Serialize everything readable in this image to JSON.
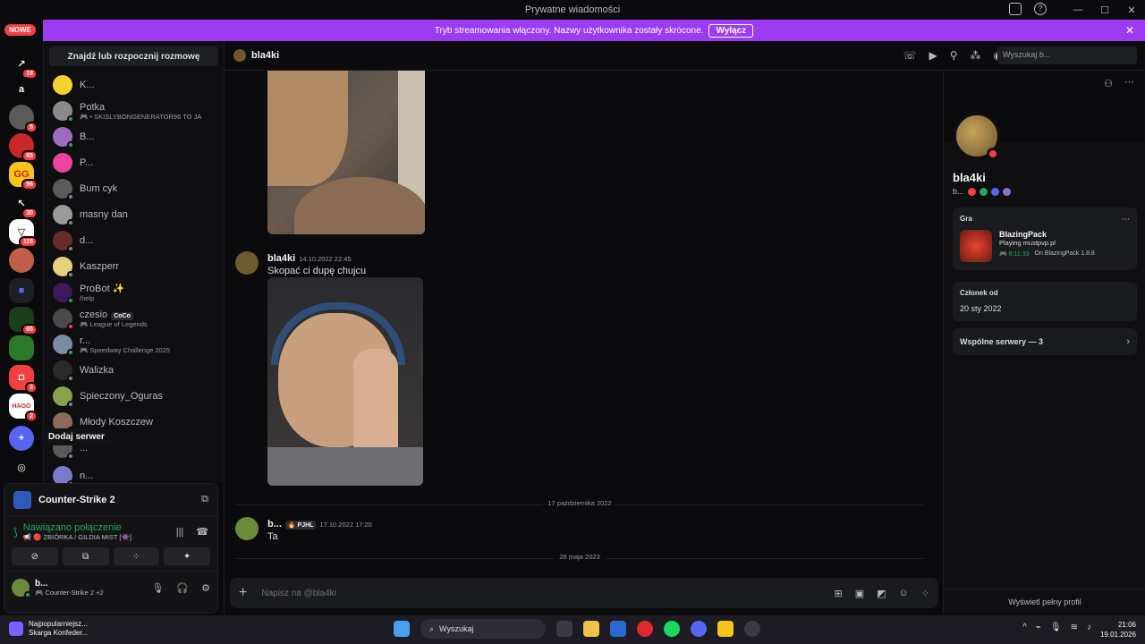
{
  "window": {
    "title": "Prywatne wiadomości"
  },
  "banner": {
    "text": "Tryb streamowania włączony. Nazwy użytkownika zostały skrócone.",
    "button": "Wyłącz"
  },
  "rail": {
    "new_badge": "NOWE",
    "servers": [
      {
        "label": "",
        "badge": "18"
      },
      {
        "label": "a",
        "badge": ""
      },
      {
        "label": "",
        "badge": "5"
      },
      {
        "label": "",
        "badge": "65"
      },
      {
        "label": "GG",
        "badge": "96"
      },
      {
        "label": "",
        "badge": "30"
      },
      {
        "label": "",
        "badge": "115"
      },
      {
        "label": "",
        "badge": ""
      },
      {
        "label": "",
        "badge": ""
      },
      {
        "label": "",
        "badge": "65"
      },
      {
        "label": "",
        "badge": ""
      },
      {
        "label": "",
        "badge": "3"
      },
      {
        "label": "HAGO",
        "badge": "2"
      }
    ],
    "tooltip": "Dodaj serwer"
  },
  "dmlist": {
    "find_button": "Znajdź lub rozpocznij rozmowę",
    "items": [
      {
        "name": "K...",
        "sub": ""
      },
      {
        "name": "Potka",
        "sub": "🎮 • SKISLYBONGENERATOR96 TO JA"
      },
      {
        "name": "B...",
        "sub": ""
      },
      {
        "name": "P...",
        "sub": ""
      },
      {
        "name": "Bum cyk",
        "sub": ""
      },
      {
        "name": "masny dan",
        "sub": ""
      },
      {
        "name": "d...",
        "sub": ""
      },
      {
        "name": "Kaszperr",
        "sub": ""
      },
      {
        "name": "ProBot ✨",
        "sub": "/help"
      },
      {
        "name": "czesio",
        "sub": "🎮 League of Legends",
        "tag": "CoCo"
      },
      {
        "name": "r...",
        "sub": "🎮 Speedway Challenge 2025"
      },
      {
        "name": "Walizka",
        "sub": ""
      },
      {
        "name": "Spieczony_Oguras",
        "sub": ""
      },
      {
        "name": "Młody Koszczew",
        "sub": ""
      },
      {
        "name": "...",
        "sub": ""
      },
      {
        "name": "n...",
        "sub": ""
      }
    ]
  },
  "voice": {
    "game": "Counter-Strike 2",
    "status": "Nawiązano połączenie",
    "channel": "📢 🔴 ZBIÓRKA / GILDIA MIST [👾]",
    "user_name": "b...",
    "user_sub": "🎮 Counter-Strike 2 +2"
  },
  "chat": {
    "recipient": "bla4ki",
    "search_placeholder": "Wyszukaj b...",
    "messages": [
      {
        "author": "bla4ki",
        "time": "14.10.2022 22:45",
        "text": "Skopać ci dupę chujcu"
      },
      {
        "author": "b...",
        "time": "17.10.2022 17:20",
        "text": "Ta",
        "tag": "🔥 PJHL"
      }
    ],
    "dividers": [
      "17 października 2022",
      "28 maja 2023"
    ],
    "input_placeholder": "Napisz na @bla4ki"
  },
  "profile": {
    "name": "bla4ki",
    "sub": "b...",
    "activity_label": "Gra",
    "game_title": "BlazingPack",
    "game_sub": "Playing mustpvp.pl",
    "game_time": "🎮 6:11:33",
    "game_extra": "On BlazingPack 1.8.8",
    "member_label": "Członek od",
    "member_date": "20 sty 2022",
    "mutual": "Wspólne serwery — 3",
    "view_full": "Wyświetl pełny profil"
  },
  "taskbar": {
    "news_title": "Najpopularniejsz...",
    "news_sub": "Skarga Konfeder...",
    "search": "Wyszukaj",
    "time": "21:06",
    "date": "19.01.2026"
  }
}
